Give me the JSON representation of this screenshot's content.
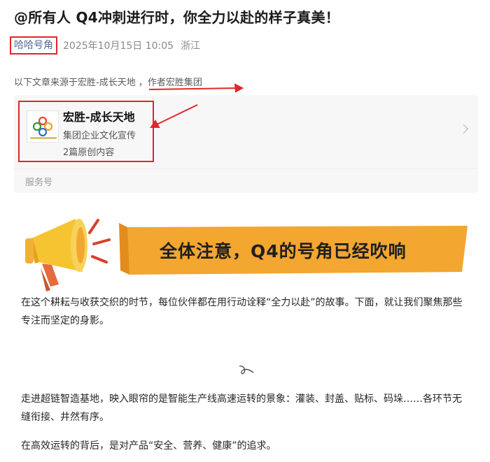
{
  "article": {
    "title": "@所有人 Q4冲刺进行时，你全力以赴的样子真美！",
    "author": "哈哈号角",
    "date": "2025年10月15日 10:05",
    "location": "浙江",
    "source_line": "以下文章来源于宏胜-成长天地 ，作者宏胜集团"
  },
  "source_card": {
    "name": "宏胜-成长天地",
    "description": "集团企业文化宣传",
    "count": "2篇原创内容",
    "footer": "服务号"
  },
  "banner": {
    "text": "全体注意，Q4的号角已经吹响"
  },
  "body": {
    "p1": "在这个耕耘与收获交织的时节，每位伙伴都在用行动诠释“全力以赴”的故事。下面，就让我们聚焦那些专注而坚定的身影。",
    "p2": "走进超链智造基地，映入眼帘的是智能生产线高速运转的景象：灌装、封盖、贴标、码垛……各环节无缝衔接、井然有序。",
    "p3": "在高效运转的背后，是对产品“安全、营养、健康”的追求。"
  },
  "colors": {
    "highlight_border": "#e0262b",
    "author_link": "#576b95",
    "banner_orange": "#f3a630"
  }
}
